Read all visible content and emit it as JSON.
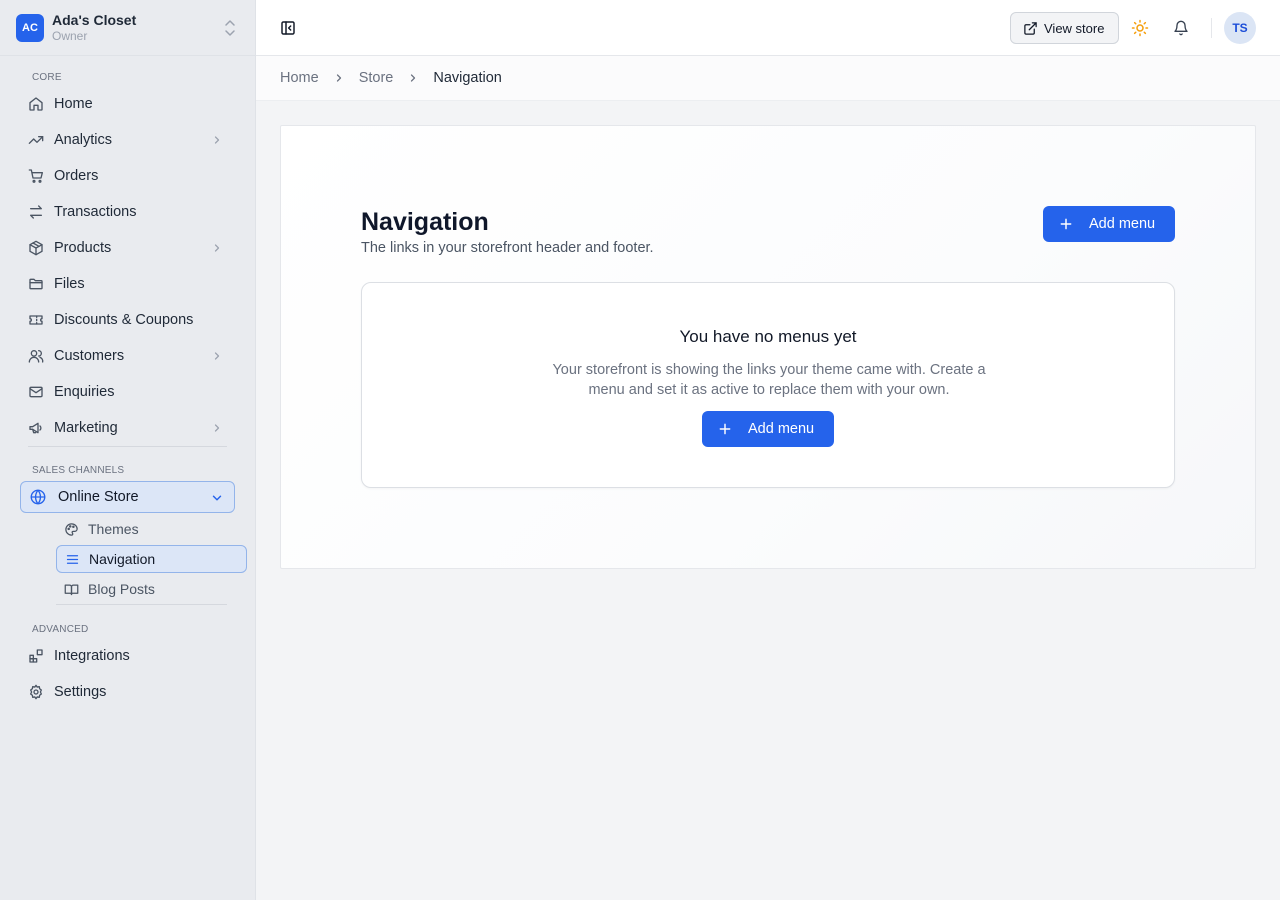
{
  "store": {
    "initials": "AC",
    "name": "Ada's Closet",
    "role": "Owner"
  },
  "sidebar": {
    "core_label": "CORE",
    "core_items": [
      {
        "label": "Home"
      },
      {
        "label": "Analytics"
      },
      {
        "label": "Orders"
      },
      {
        "label": "Transactions"
      },
      {
        "label": "Products"
      },
      {
        "label": "Files"
      },
      {
        "label": "Discounts & Coupons"
      },
      {
        "label": "Customers"
      },
      {
        "label": "Enquiries"
      },
      {
        "label": "Marketing"
      }
    ],
    "sales_label": "SALES CHANNELS",
    "online_store": "Online Store",
    "online_store_items": [
      {
        "label": "Themes"
      },
      {
        "label": "Navigation"
      },
      {
        "label": "Blog Posts"
      }
    ],
    "advanced_label": "ADVANCED",
    "advanced_items": [
      {
        "label": "Integrations"
      },
      {
        "label": "Settings"
      }
    ]
  },
  "topbar": {
    "view_store_label": "View store",
    "user_initials": "TS"
  },
  "breadcrumb": [
    "Home",
    "Store",
    "Navigation"
  ],
  "page": {
    "title": "Navigation",
    "subtitle": "The links in your storefront header and footer.",
    "add_menu_label": "Add menu"
  },
  "empty_state": {
    "title": "You have no menus yet",
    "description": "Your storefront is showing the links your theme came with. Create a menu and set it as active to replace them with your own.",
    "add_menu_label": "Add menu"
  },
  "colors": {
    "accent": "#2563eb",
    "sidebar_bg": "#e9ebef",
    "page_bg": "#f3f4f6"
  }
}
